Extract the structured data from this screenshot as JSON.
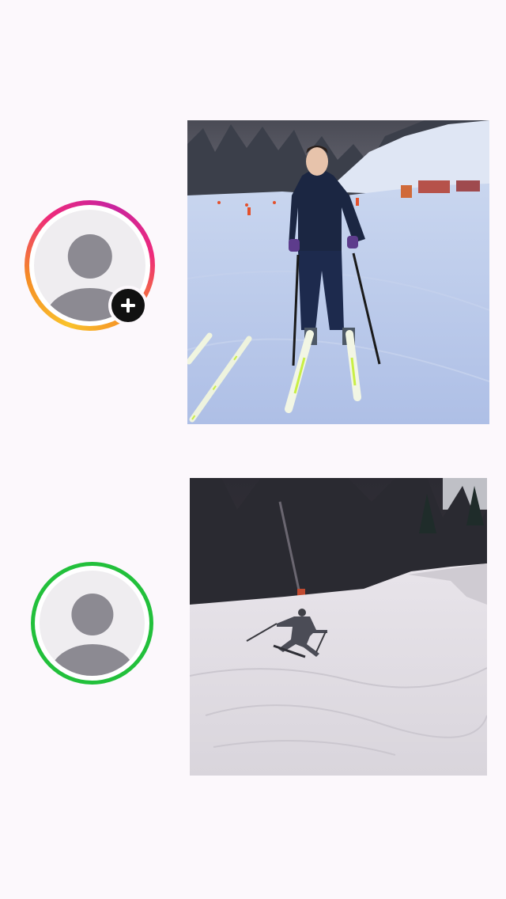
{
  "screen": {
    "background": "#fcf8fc"
  },
  "stories": [
    {
      "avatar": {
        "ring": "gradient",
        "ring_colors": [
          "#f9c22b",
          "#f58b26",
          "#ee2a7b",
          "#c8249f"
        ],
        "placeholder_icon": "default-user-icon",
        "badge_icon": "plus-icon"
      },
      "photo": {
        "subject": "skier-standing-on-slope-photo"
      }
    },
    {
      "avatar": {
        "ring": "solid",
        "ring_colors": [
          "#22c03b"
        ],
        "placeholder_icon": "default-user-icon"
      },
      "photo": {
        "subject": "skier-turning-downhill-photo"
      }
    }
  ]
}
